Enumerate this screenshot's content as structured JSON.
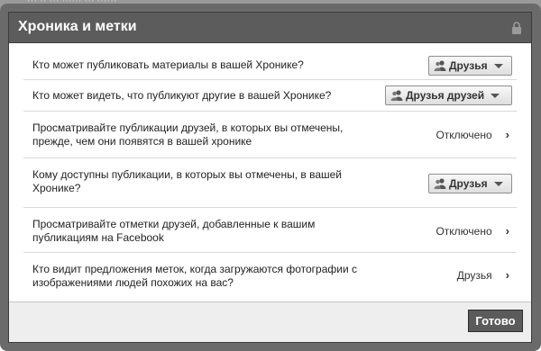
{
  "top_strip": {
    "text": "··· ·· ··· ······ ··· ······"
  },
  "dialog": {
    "title": "Хроника и метки",
    "lock_icon": "lock-icon"
  },
  "rows": [
    {
      "label": "Кто может публиковать материалы в вашей Хронике?",
      "control": "select",
      "value": "Друзья",
      "icon": "people-icon"
    },
    {
      "label": "Кто может видеть, что публикуют другие в вашей Хронике?",
      "control": "select",
      "value": "Друзья друзей",
      "icon": "people-icon"
    },
    {
      "label": "Просматривайте публикации друзей, в которых вы отмечены, прежде, чем они появятся в вашей хронике",
      "control": "link",
      "value": "Отключено",
      "icon": "chevron-right-icon"
    },
    {
      "label": "Кому доступны публикации, в которых вы отмечены, в вашей Хронике?",
      "control": "select",
      "value": "Друзья",
      "icon": "people-icon"
    },
    {
      "label": "Просматривайте отметки друзей, добавленные к вашим публикациям на Facebook",
      "control": "link",
      "value": "Отключено",
      "icon": "chevron-right-icon"
    },
    {
      "label": "Кто видит предложения меток, когда загружаются фотографии с изображениями людей похожих на вас?",
      "control": "link",
      "value": "Друзья",
      "icon": "chevron-right-icon"
    }
  ],
  "footer": {
    "done_label": "Готово"
  },
  "colors": {
    "header_bg": "#5c5c5c",
    "frame_bg": "#6a6a6a",
    "footer_bg": "#eeeeee",
    "done_bg": "#5b5b5b"
  }
}
